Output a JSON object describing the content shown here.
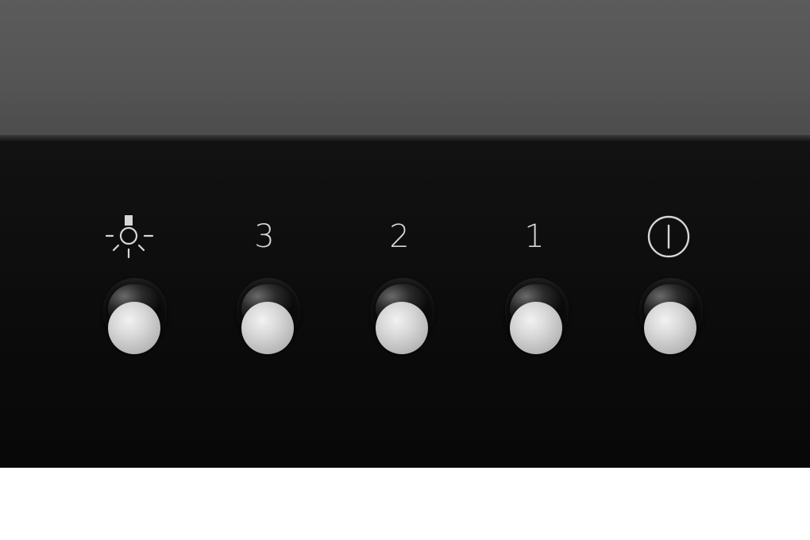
{
  "panel": {
    "label_speed_3": "3",
    "label_speed_2": "2",
    "label_speed_1": "1"
  },
  "icons": {
    "light": "light-bulb-icon",
    "power": "power-icon"
  },
  "colors": {
    "panel": "#0b0b0b",
    "hood_top": "#555555",
    "label": "#d6d6d6",
    "button_cap": "#c8c8c8",
    "background": "#ffffff"
  }
}
